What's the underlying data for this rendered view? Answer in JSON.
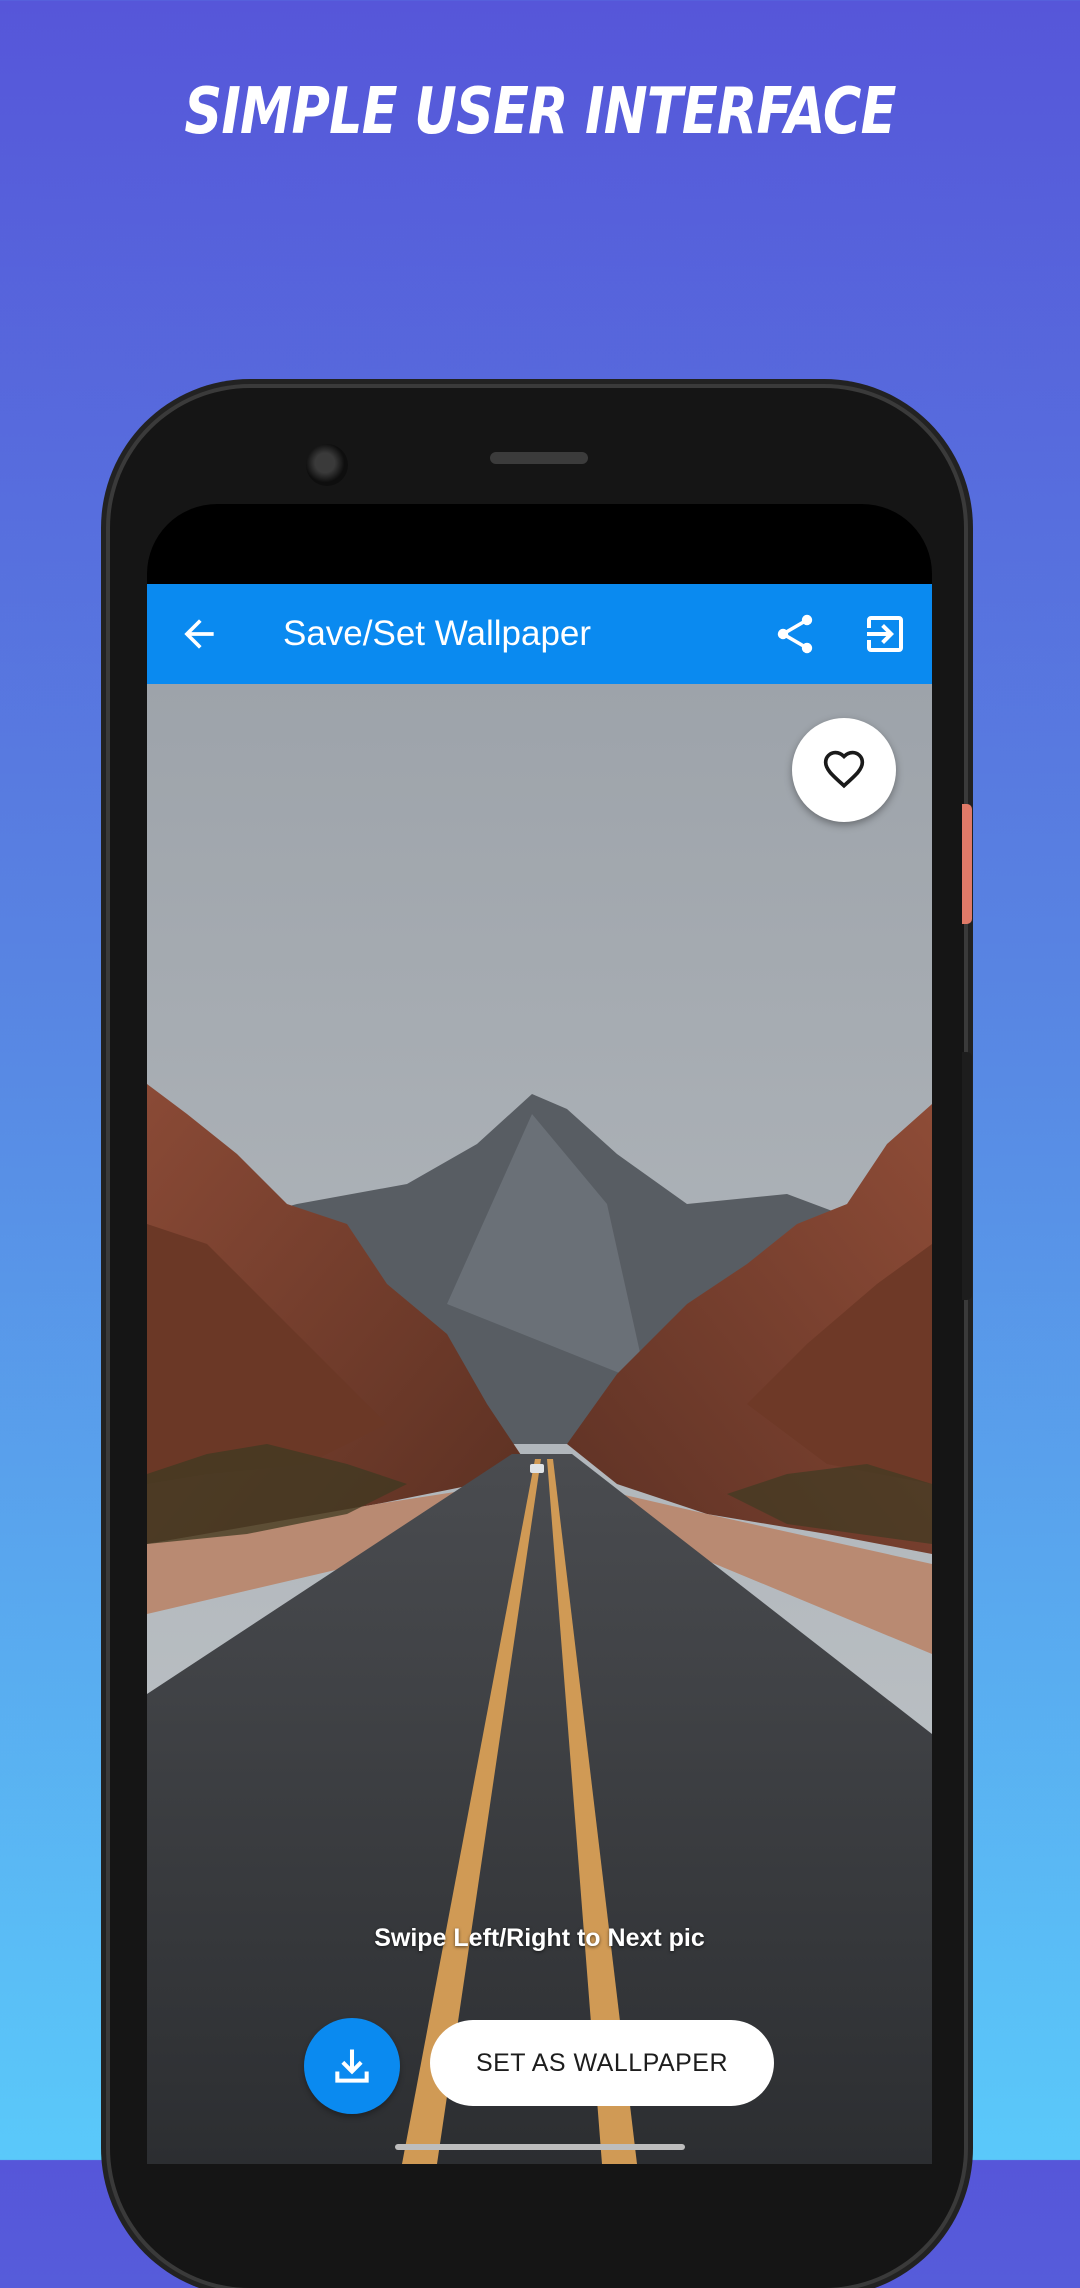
{
  "promo": {
    "title": "Simple User Interface"
  },
  "appbar": {
    "title": "Save/Set Wallpaper",
    "back_icon": "arrow-left-icon",
    "share_icon": "share-icon",
    "exit_icon": "exit-to-app-icon",
    "color": "#0a8af0"
  },
  "favorite": {
    "icon": "heart-outline-icon"
  },
  "hint": {
    "text": "Swipe Left/Right to Next pic"
  },
  "actions": {
    "download_icon": "download-icon",
    "set_wallpaper_label": "SET AS WALLPAPER"
  },
  "colors": {
    "background_top": "#5656d9",
    "background_bottom": "#5ac9fa",
    "accent": "#0a8af0"
  }
}
